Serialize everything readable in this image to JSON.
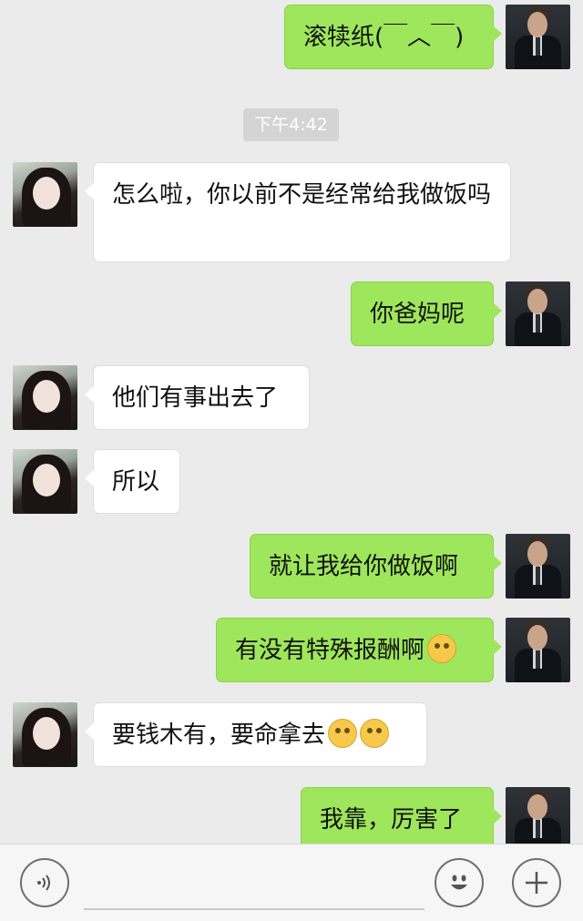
{
  "messages": [
    {
      "side": "right",
      "avatar": "male",
      "text": "滚犊纸(￣︿￣)",
      "emojis": 0
    },
    {
      "side": "left",
      "avatar": "female",
      "text": "怎么啦，你以前不是经常给我做饭吗",
      "emojis": 0
    },
    {
      "side": "right",
      "avatar": "male",
      "text": "你爸妈呢",
      "emojis": 0
    },
    {
      "side": "left",
      "avatar": "female",
      "text": "他们有事出去了",
      "emojis": 0
    },
    {
      "side": "left",
      "avatar": "female",
      "text": "所以",
      "emojis": 0
    },
    {
      "side": "right",
      "avatar": "male",
      "text": "就让我给你做饭啊",
      "emojis": 0
    },
    {
      "side": "right",
      "avatar": "male",
      "text": "有没有特殊报酬啊",
      "emojis": 1
    },
    {
      "side": "left",
      "avatar": "female",
      "text": "要钱木有，要命拿去",
      "emojis": 2
    },
    {
      "side": "right",
      "avatar": "male",
      "text": "我靠，厉害了",
      "emojis": 0
    }
  ],
  "timestamp": "下午4:42",
  "input": {
    "value": "",
    "placeholder": ""
  },
  "icons": {
    "voice": "voice-icon",
    "emoji": "smiley-icon",
    "plus": "plus-icon"
  },
  "colors": {
    "background": "#ebebeb",
    "sent_bubble": "#9ee65b",
    "received_bubble": "#ffffff"
  }
}
